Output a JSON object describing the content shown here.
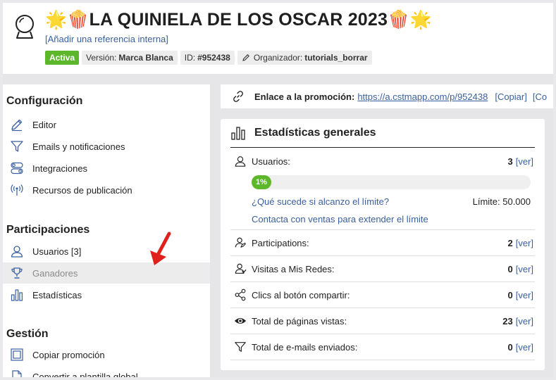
{
  "header": {
    "title": "🌟🍿LA QUINIELA DE LOS OSCAR 2023🍿🌟",
    "reference_prefix": "[",
    "reference_link": "Añadir una referencia interna",
    "reference_suffix": "]",
    "badges": {
      "status": "Activa",
      "version_label": "Versión:",
      "version_value": "Marca Blanca",
      "id_label": "ID:",
      "id_value": "#952438",
      "organizer_label": "Organizador:",
      "organizer_value": "tutorials_borrar"
    }
  },
  "sidebar": {
    "sections": {
      "config": "Configuración",
      "participations": "Participaciones",
      "management": "Gestión"
    },
    "items": {
      "editor": "Editor",
      "emails": "Emails y notificaciones",
      "integrations": "Integraciones",
      "resources": "Recursos de publicación",
      "users": "Usuarios [3]",
      "winners": "Ganadores",
      "stats": "Estadísticas",
      "copy": "Copiar promoción",
      "template": "Convertir a plantilla global"
    }
  },
  "linkbar": {
    "label": "Enlace a la promoción:",
    "url": "https://a.cstmapp.com/p/952438",
    "copy": "[Copiar]",
    "next": "[Co"
  },
  "stats": {
    "title": "Estadísticas generales",
    "users": {
      "label": "Usuarios:",
      "value": "3",
      "ver": "ver",
      "progress_label": "1%",
      "progress_fraction": 0.01,
      "limit_question": "¿Qué sucede si alcanzo el límite?",
      "limit_label": "Límite: 50.000",
      "contact": "Contacta con ventas para extender el límite"
    },
    "rows": [
      {
        "label": "Participations:",
        "value": "2",
        "ver": "ver",
        "icon": "participation-icon"
      },
      {
        "label": "Visitas a Mis Redes:",
        "value": "0",
        "ver": "ver",
        "icon": "user-visits-icon"
      },
      {
        "label": "Clics al botón compartir:",
        "value": "0",
        "ver": "ver",
        "icon": "share-icon"
      },
      {
        "label": "Total de páginas vistas:",
        "value": "23",
        "ver": "ver",
        "icon": "eye-icon"
      },
      {
        "label": "Total de e-mails enviados:",
        "value": "0",
        "ver": "ver",
        "icon": "send-icon"
      }
    ],
    "bracket_open": "[",
    "bracket_close": "]"
  },
  "colors": {
    "accent_green": "#5cb82a",
    "link_blue": "#3a5f9e",
    "arrow_red": "#e0201b"
  }
}
